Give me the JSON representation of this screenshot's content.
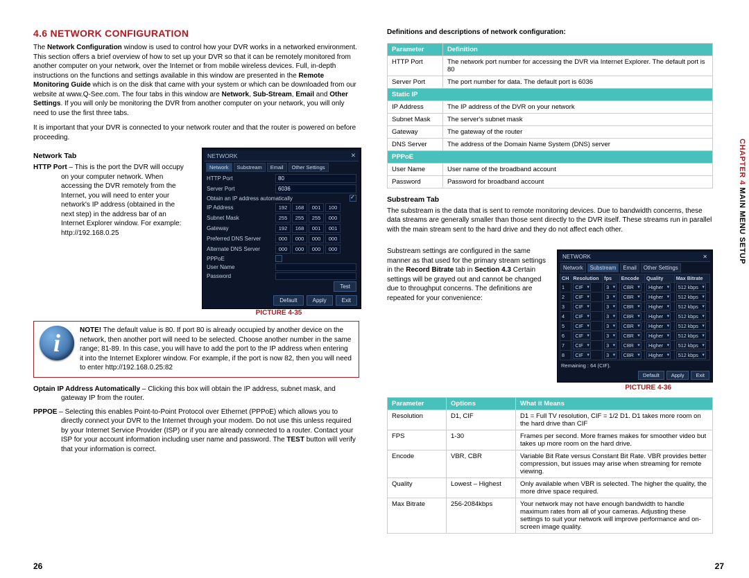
{
  "section_title": "4.6 NETWORK CONFIGURATION",
  "intro_p1_a": "The ",
  "intro_p1_bold": "Network Configuration",
  "intro_p1_b": " window is used to control how your DVR works in a networked environment. This section offers a brief overview of how to set up your DVR so that it can be remotely monitored from another computer on your network, over the Internet or from mobile wireless devices. Full, in-depth instructions on the functions and settings available in this window are presented in the ",
  "intro_p1_bold2": "Remote Monitoring Guide",
  "intro_p1_c": " which is on the disk that came with your system or which can be downloaded from our website at www.Q-See.com. The four tabs in this window are ",
  "intro_p1_bold3": "Network",
  "intro_p1_d": ", ",
  "intro_p1_bold4": "Sub-Stream",
  "intro_p1_e": ", ",
  "intro_p1_bold5": "Email",
  "intro_p1_f": " and ",
  "intro_p1_bold6": "Other Settings",
  "intro_p1_g": ". If you will only be monitoring the DVR from another computer on your network, you will only need to use the first three tabs.",
  "intro_p2": "It is important that your DVR is connected to your network router and that the router is powered on before proceeding.",
  "network_tab_head": "Network Tab",
  "http_lead": "HTTP Port",
  "http_body": " – This is the port the DVR will occupy on your computer network. When accessing the DVR remotely from the Internet, you will need to enter your network's IP address (obtained in the next step) in the address bar of an Internet Explorer window. For example: http://192.168.0.25",
  "picture35": "PICTURE 4-35",
  "note_lead": "NOTE!",
  "note_body": " The default value is 80. If port 80 is already occupied by another device on the network, then another port will need to be selected. Choose another number in the same range; 81-89. In this case, you will have to add the port to the IP address when entering it into the Internet Explorer window. For example, if the port is now 82, then you will need to enter http://192.168.0.25:82",
  "obtain_lead": "Optain IP Address Automatically",
  "obtain_body": " – Clicking this box will obtain the IP address, subnet mask, and gateway IP from the router.",
  "pppoe_lead": "PPPOE",
  "pppoe_body_a": " – Selecting this enables Point-to-Point Protocol over Ethernet (PPPoE) which allows you to directly connect your DVR to the Internet through your modem. Do not use this unless required by your Internet Service Provider (ISP) or if you are already connected to a router. Contact your ISP for your account information including user name and password. The ",
  "pppoe_body_bold": "TEST",
  "pppoe_body_b": " button will verify that your information is correct.",
  "net_dialog": {
    "title": "NETWORK",
    "close": "✕",
    "tabs": [
      "Network",
      "Substream",
      "Email",
      "Other Settings"
    ],
    "rows": {
      "http_port": {
        "label": "HTTP Port",
        "value": "80"
      },
      "server_port": {
        "label": "Server Port",
        "value": "6036"
      },
      "obtain": {
        "label": "Obtain an IP address automatically"
      },
      "ip": {
        "label": "IP Address",
        "seg": [
          "192",
          "168",
          "001",
          "100"
        ]
      },
      "mask": {
        "label": "Subnet Mask",
        "seg": [
          "255",
          "255",
          "255",
          "000"
        ]
      },
      "gw": {
        "label": "Gateway",
        "seg": [
          "192",
          "168",
          "001",
          "001"
        ]
      },
      "pdns": {
        "label": "Preferred DNS Server",
        "seg": [
          "000",
          "000",
          "000",
          "000"
        ]
      },
      "adns": {
        "label": "Alternate DNS Server",
        "seg": [
          "000",
          "000",
          "000",
          "000"
        ]
      },
      "pppoe": {
        "label": "PPPoE"
      },
      "user": {
        "label": "User Name"
      },
      "pass": {
        "label": "Password"
      },
      "test": "Test"
    },
    "btns": {
      "default": "Default",
      "apply": "Apply",
      "exit": "Exit"
    }
  },
  "right_head": "Definitions and descriptions of network configuration:",
  "def_table": {
    "headers": [
      "Parameter",
      "Definition"
    ],
    "rows": [
      {
        "p": "HTTP Port",
        "d": "The network port number for accessing the DVR via Internet Explorer. The default port is 80"
      },
      {
        "p": "Server Port",
        "d": "The port number for data. The default port is 6036"
      }
    ],
    "group_static": "Static IP",
    "static_rows": [
      {
        "p": "IP Address",
        "d": "The IP address of the DVR on your network"
      },
      {
        "p": "Subnet Mask",
        "d": "The server's subnet mask"
      },
      {
        "p": "Gateway",
        "d": "The gateway of the router"
      },
      {
        "p": "DNS Server",
        "d": "The address of the Domain Name System (DNS) server"
      }
    ],
    "group_pppoe": "PPPoE",
    "pppoe_rows": [
      {
        "p": "User Name",
        "d": "User name of the broadband account"
      },
      {
        "p": "Password",
        "d": "Password for broadband account"
      }
    ]
  },
  "substream_head": "Substream Tab",
  "substream_p1": "The substream is the data that is sent to remote monitoring devices. Due to bandwidth concerns, these data streams are generally smaller than those sent directly to the DVR itself. These streams run in parallel with the main stream sent to the hard drive and they do not affect each other.",
  "substream_p2_a": "Substream settings are configured in the same manner as that used for the primary stream settings in the ",
  "substream_p2_bold1": "Record Bitrate",
  "substream_p2_b": " tab in ",
  "substream_p2_bold2": "Section 4.3",
  "substream_p2_c": " Certain settings will be grayed out and cannot be changed due to throughput concerns. The definitions are repeated for your convenience:",
  "picture36": "PICTURE 4-36",
  "sub_dialog": {
    "title": "NETWORK",
    "headers": [
      "CH",
      "Resolution",
      "fps",
      "Encode",
      "Quality",
      "Max Bitrate"
    ],
    "rows": [
      {
        "ch": "1",
        "res": "CIF",
        "fps": "3",
        "enc": "CBR",
        "q": "Higher",
        "br": "512 kbps"
      },
      {
        "ch": "2",
        "res": "CIF",
        "fps": "3",
        "enc": "CBR",
        "q": "Higher",
        "br": "512 kbps"
      },
      {
        "ch": "3",
        "res": "CIF",
        "fps": "3",
        "enc": "CBR",
        "q": "Higher",
        "br": "512 kbps"
      },
      {
        "ch": "4",
        "res": "CIF",
        "fps": "3",
        "enc": "CBR",
        "q": "Higher",
        "br": "512 kbps"
      },
      {
        "ch": "5",
        "res": "CIF",
        "fps": "3",
        "enc": "CBR",
        "q": "Higher",
        "br": "512 kbps"
      },
      {
        "ch": "6",
        "res": "CIF",
        "fps": "3",
        "enc": "CBR",
        "q": "Higher",
        "br": "512 kbps"
      },
      {
        "ch": "7",
        "res": "CIF",
        "fps": "3",
        "enc": "CBR",
        "q": "Higher",
        "br": "512 kbps"
      },
      {
        "ch": "8",
        "res": "CIF",
        "fps": "3",
        "enc": "CBR",
        "q": "Higher",
        "br": "512 kbps"
      }
    ],
    "remaining_label": "Remaining : ",
    "remaining_value": "64 (CIF).",
    "btns": {
      "default": "Default",
      "apply": "Apply",
      "exit": "Exit"
    }
  },
  "options_table": {
    "headers": [
      "Parameter",
      "Options",
      "What it Means"
    ],
    "rows": [
      {
        "p": "Resolution",
        "o": "D1, CIF",
        "m": "D1 = Full TV resolution, CIF = 1/2 D1. D1 takes more room on the hard drive than CIF"
      },
      {
        "p": "FPS",
        "o": "1-30",
        "m": "Frames per second. More frames makes for smoother video but takes up more room on the hard drive."
      },
      {
        "p": "Encode",
        "o": "VBR, CBR",
        "m": "Variable Bit Rate versus Constant Bit Rate. VBR provides better compression, but issues may arise when streaming for remote viewing."
      },
      {
        "p": "Quality",
        "o": "Lowest – Highest",
        "m": "Only available when VBR is selected. The higher the quality, the more drive space required."
      },
      {
        "p": "Max Bitrate",
        "o": "256-2084kbps",
        "m": "Your network may not have enough bandwidth to handle maximum rates from all of your cameras. Adjusting these settings to suit your network will improve performance and on-screen image quality."
      }
    ]
  },
  "side_tab_chapter": "CHAPTER 4",
  "side_tab_rest": "  MAIN MENU SETUP",
  "page_left": "26",
  "page_right": "27"
}
